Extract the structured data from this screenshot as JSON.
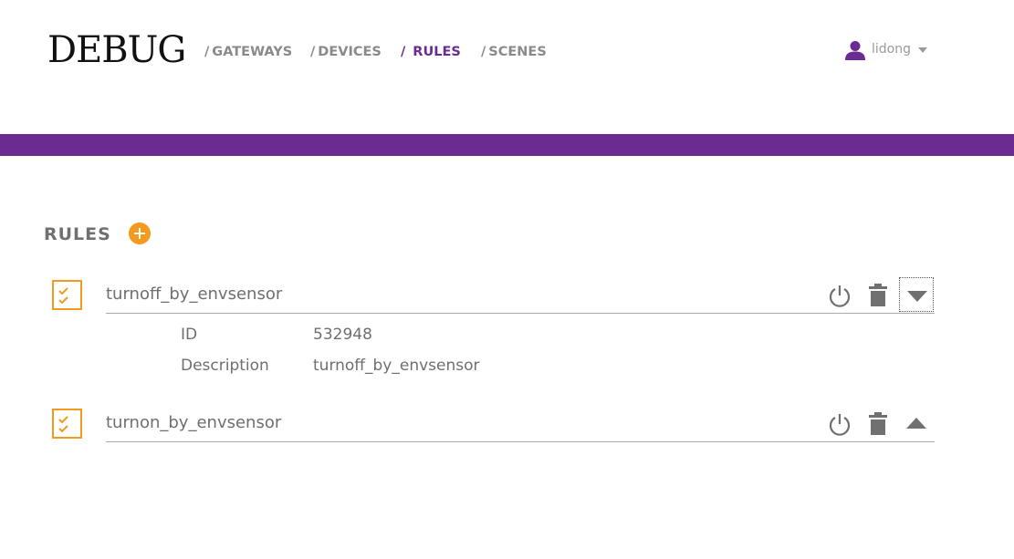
{
  "header": {
    "logo": "DEBUG",
    "nav": [
      {
        "slash": "/",
        "label": "GATEWAYS",
        "active": false
      },
      {
        "slash": "/",
        "label": "DEVICES",
        "active": false
      },
      {
        "slash": "/",
        "label": "RULES",
        "active": true
      },
      {
        "slash": "/",
        "label": "SCENES",
        "active": false
      }
    ],
    "user": {
      "name": "lidong",
      "icon": "user-icon",
      "caret_icon": "caret-down-icon"
    }
  },
  "colors": {
    "accent_purple": "#6a2c91",
    "accent_orange": "#f39a1f",
    "text_gray": "#6f6f6f"
  },
  "rules_section": {
    "title": "RULES",
    "add_icon": "plus-icon",
    "rules": [
      {
        "name": "turnoff_by_envsensor",
        "expanded": true,
        "details": [
          {
            "label": "ID",
            "value": "532948"
          },
          {
            "label": "Description",
            "value": "turnoff_by_envsensor"
          }
        ]
      },
      {
        "name": "turnon_by_envsensor",
        "expanded": false
      }
    ]
  }
}
